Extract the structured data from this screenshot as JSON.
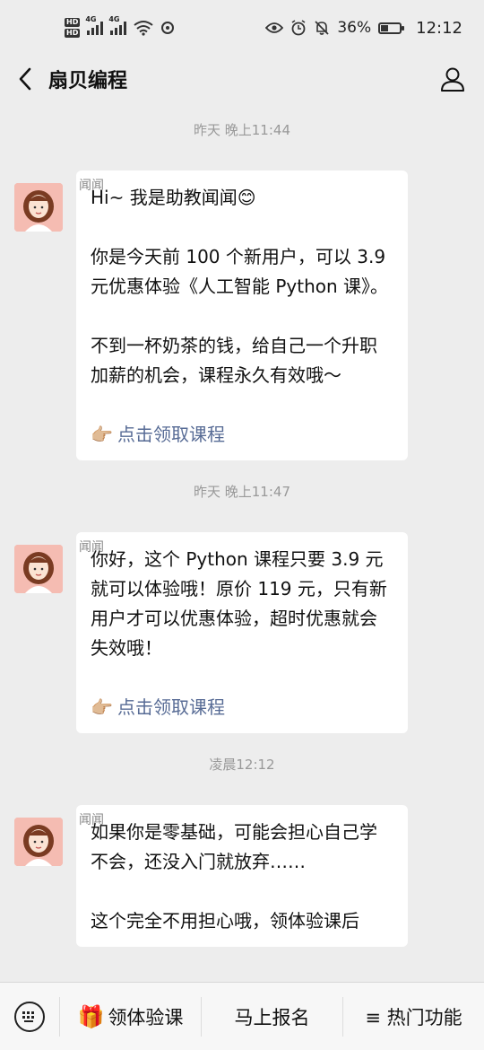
{
  "status_bar": {
    "hd1": "HD",
    "hd2": "HD",
    "net1": "4G",
    "net2": "4G",
    "battery": "36%",
    "battery_level": 0.36,
    "time": "12:12"
  },
  "header": {
    "title": "扇贝编程"
  },
  "messages": [
    {
      "timestamp": "昨天 晚上11:44",
      "sender": "闻闻",
      "lines": [
        "Hi~ 我是助教闻闻😊",
        "你是今天前 100 个新用户，可以 3.9 元优惠体验《人工智能 Python 课》。",
        "不到一杯奶茶的钱，给自己一个升职加薪的机会，课程永久有效哦～"
      ],
      "link": "点击领取课程"
    },
    {
      "timestamp": "昨天 晚上11:47",
      "sender": "闻闻",
      "lines": [
        "你好，这个 Python 课程只要 3.9 元就可以体验哦！原价 119 元，只有新用户才可以优惠体验，超时优惠就会失效哦！"
      ],
      "link": "点击领取课程"
    },
    {
      "timestamp": "凌晨12:12",
      "sender": "闻闻",
      "lines": [
        "如果你是零基础，可能会担心自己学不会，还没入门就放弃……",
        "这个完全不用担心哦，领体验课后"
      ]
    }
  ],
  "bottom_menu": {
    "btn1": "领体验课",
    "btn2": "马上报名",
    "btn3": "≡ 热门功能"
  }
}
